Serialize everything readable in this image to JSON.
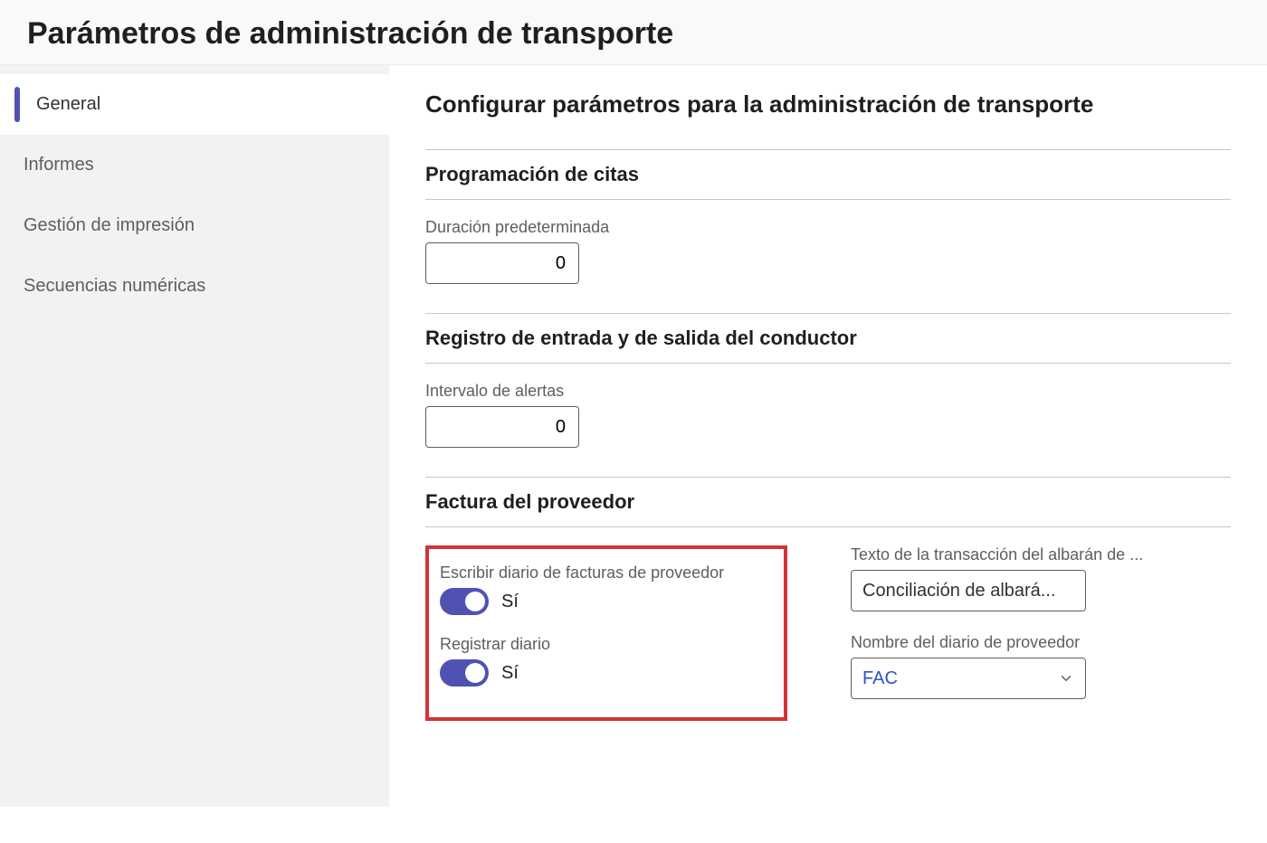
{
  "header": {
    "title": "Parámetros de administración de transporte"
  },
  "sidebar": {
    "items": [
      {
        "label": "General",
        "active": true
      },
      {
        "label": "Informes",
        "active": false
      },
      {
        "label": "Gestión de impresión",
        "active": false
      },
      {
        "label": "Secuencias numéricas",
        "active": false
      }
    ]
  },
  "main": {
    "title": "Configurar parámetros para la administración de transporte",
    "sections": {
      "citas": {
        "title": "Programación de citas",
        "duracion_label": "Duración predeterminada",
        "duracion_value": "0"
      },
      "registro": {
        "title": "Registro de entrada y de salida del conductor",
        "intervalo_label": "Intervalo de alertas",
        "intervalo_value": "0"
      },
      "factura": {
        "title": "Factura del proveedor",
        "escribir_diario_label": "Escribir diario de facturas de proveedor",
        "escribir_diario_state": "Sí",
        "registrar_diario_label": "Registrar diario",
        "registrar_diario_state": "Sí",
        "texto_transaccion_label": "Texto de la transacción del albarán de ...",
        "texto_transaccion_value": "Conciliación de albará...",
        "nombre_diario_label": "Nombre del diario de proveedor",
        "nombre_diario_value": "FAC"
      }
    }
  }
}
